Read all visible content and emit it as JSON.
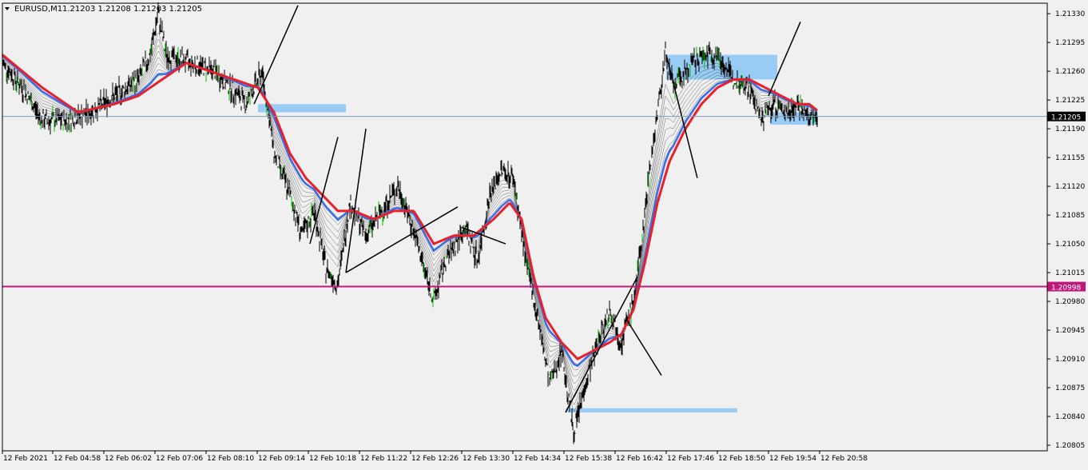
{
  "header": {
    "symbol": "EURUSD,M1",
    "ohlc": "1.21203 1.21208 1.21203 1.21205",
    "menu_icon": "triangle-down-icon"
  },
  "colors": {
    "background": "#f0f0f0",
    "axis": "#000000",
    "candles": "#000000",
    "bull_candle": "#00c000",
    "ma_red": "#e8202a",
    "ma_blue": "#3a6de8",
    "ma_ribbon": "#000000",
    "rect_fill": "#99ccf5",
    "current_price_line": "#7f9bb8",
    "level_line": "#c0187a"
  },
  "chart_data": {
    "type": "line",
    "title": "",
    "xlabel": "",
    "ylabel": "",
    "ylim": [
      1.20805,
      1.2135
    ],
    "y_ticks": [
      "1.21330",
      "1.21295",
      "1.21260",
      "1.21225",
      "1.21190",
      "1.21155",
      "1.21120",
      "1.21085",
      "1.21050",
      "1.21015",
      "1.20980",
      "1.20945",
      "1.20910",
      "1.20875",
      "1.20840",
      "1.20805"
    ],
    "x_ticks": [
      "12 Feb 2021",
      "12 Feb 04:58",
      "12 Feb 06:02",
      "12 Feb 07:06",
      "12 Feb 08:10",
      "12 Feb 09:14",
      "12 Feb 10:18",
      "12 Feb 11:22",
      "12 Feb 12:26",
      "12 Feb 13:30",
      "12 Feb 14:34",
      "12 Feb 15:38",
      "12 Feb 16:42",
      "12 Feb 17:46",
      "12 Feb 18:50",
      "12 Feb 19:54",
      "12 Feb 20:58"
    ],
    "current_price": {
      "value": 1.21205,
      "label": "1.21205"
    },
    "level_price": {
      "value": 1.20998,
      "label": "1.20998"
    },
    "price_path": [
      [
        "12 Feb 03:55",
        1.2127
      ],
      [
        "12 Feb 04:20",
        1.2124
      ],
      [
        "12 Feb 04:45",
        1.212
      ],
      [
        "12 Feb 05:15",
        1.212
      ],
      [
        "12 Feb 05:45",
        1.2121
      ],
      [
        "12 Feb 06:15",
        1.2123
      ],
      [
        "12 Feb 06:45",
        1.2125
      ],
      [
        "12 Feb 07:00",
        1.2128
      ],
      [
        "12 Feb 07:10",
        1.2133
      ],
      [
        "12 Feb 07:20",
        1.2128
      ],
      [
        "12 Feb 07:50",
        1.2127
      ],
      [
        "12 Feb 08:20",
        1.2126
      ],
      [
        "12 Feb 08:40",
        1.2124
      ],
      [
        "12 Feb 09:00",
        1.2122
      ],
      [
        "12 Feb 09:20",
        1.2126
      ],
      [
        "12 Feb 09:35",
        1.2116
      ],
      [
        "12 Feb 09:55",
        1.2111
      ],
      [
        "12 Feb 10:10",
        1.2106
      ],
      [
        "12 Feb 10:25",
        1.2109
      ],
      [
        "12 Feb 10:40",
        1.2102
      ],
      [
        "12 Feb 10:55",
        1.21
      ],
      [
        "12 Feb 11:10",
        1.211
      ],
      [
        "12 Feb 11:30",
        1.2106
      ],
      [
        "12 Feb 11:50",
        1.2109
      ],
      [
        "12 Feb 12:10",
        1.2112
      ],
      [
        "12 Feb 12:25",
        1.2108
      ],
      [
        "12 Feb 12:40",
        1.2103
      ],
      [
        "12 Feb 12:55",
        1.2098
      ],
      [
        "12 Feb 13:10",
        1.2103
      ],
      [
        "12 Feb 13:35",
        1.2107
      ],
      [
        "12 Feb 13:50",
        1.2103
      ],
      [
        "12 Feb 14:05",
        1.2111
      ],
      [
        "12 Feb 14:20",
        1.2114
      ],
      [
        "12 Feb 14:35",
        1.2113
      ],
      [
        "12 Feb 14:50",
        1.2103
      ],
      [
        "12 Feb 15:05",
        1.2096
      ],
      [
        "12 Feb 15:20",
        1.2088
      ],
      [
        "12 Feb 15:35",
        1.2092
      ],
      [
        "12 Feb 15:50",
        1.2082
      ],
      [
        "12 Feb 16:05",
        1.2088
      ],
      [
        "12 Feb 16:20",
        1.2093
      ],
      [
        "12 Feb 16:35",
        1.2097
      ],
      [
        "12 Feb 16:50",
        1.2093
      ],
      [
        "12 Feb 17:05",
        1.2098
      ],
      [
        "12 Feb 17:15",
        1.2105
      ],
      [
        "12 Feb 17:25",
        1.2114
      ],
      [
        "12 Feb 17:35",
        1.2121
      ],
      [
        "12 Feb 17:45",
        1.2128
      ],
      [
        "12 Feb 17:55",
        1.2124
      ],
      [
        "12 Feb 18:10",
        1.2126
      ],
      [
        "12 Feb 18:30",
        1.2128
      ],
      [
        "12 Feb 18:50",
        1.2128
      ],
      [
        "12 Feb 19:10",
        1.2125
      ],
      [
        "12 Feb 19:30",
        1.2124
      ],
      [
        "12 Feb 19:45",
        1.212
      ],
      [
        "12 Feb 20:00",
        1.2122
      ],
      [
        "12 Feb 20:15",
        1.2121
      ],
      [
        "12 Feb 20:30",
        1.2122
      ],
      [
        "12 Feb 20:45",
        1.212
      ],
      [
        "12 Feb 20:55",
        1.21205
      ]
    ],
    "ma_red_path": [
      [
        "12 Feb 03:55",
        1.2128
      ],
      [
        "12 Feb 04:45",
        1.2124
      ],
      [
        "12 Feb 05:30",
        1.2121
      ],
      [
        "12 Feb 06:15",
        1.2122
      ],
      [
        "12 Feb 06:45",
        1.2123
      ],
      [
        "12 Feb 07:15",
        1.2125
      ],
      [
        "12 Feb 07:45",
        1.2127
      ],
      [
        "12 Feb 08:15",
        1.2126
      ],
      [
        "12 Feb 08:45",
        1.2125
      ],
      [
        "12 Feb 09:15",
        1.2124
      ],
      [
        "12 Feb 09:35",
        1.2121
      ],
      [
        "12 Feb 09:55",
        1.2116
      ],
      [
        "12 Feb 10:15",
        1.2113
      ],
      [
        "12 Feb 10:35",
        1.2111
      ],
      [
        "12 Feb 10:55",
        1.2109
      ],
      [
        "12 Feb 11:15",
        1.2109
      ],
      [
        "12 Feb 11:40",
        1.2108
      ],
      [
        "12 Feb 12:05",
        1.2109
      ],
      [
        "12 Feb 12:30",
        1.2109
      ],
      [
        "12 Feb 12:55",
        1.2105
      ],
      [
        "12 Feb 13:20",
        1.2106
      ],
      [
        "12 Feb 13:45",
        1.2106
      ],
      [
        "12 Feb 14:10",
        1.2108
      ],
      [
        "12 Feb 14:30",
        1.211
      ],
      [
        "12 Feb 14:45",
        1.2108
      ],
      [
        "12 Feb 15:00",
        1.2101
      ],
      [
        "12 Feb 15:15",
        1.2096
      ],
      [
        "12 Feb 15:35",
        1.2093
      ],
      [
        "12 Feb 15:55",
        1.2091
      ],
      [
        "12 Feb 16:15",
        1.2092
      ],
      [
        "12 Feb 16:35",
        1.2093
      ],
      [
        "12 Feb 16:50",
        1.2094
      ],
      [
        "12 Feb 17:05",
        1.2097
      ],
      [
        "12 Feb 17:20",
        1.2103
      ],
      [
        "12 Feb 17:35",
        1.211
      ],
      [
        "12 Feb 17:50",
        1.2115
      ],
      [
        "12 Feb 18:10",
        1.2119
      ],
      [
        "12 Feb 18:30",
        1.2122
      ],
      [
        "12 Feb 18:50",
        1.2124
      ],
      [
        "12 Feb 19:10",
        1.2125
      ],
      [
        "12 Feb 19:30",
        1.2125
      ],
      [
        "12 Feb 19:50",
        1.2124
      ],
      [
        "12 Feb 20:10",
        1.2123
      ],
      [
        "12 Feb 20:30",
        1.2122
      ],
      [
        "12 Feb 20:45",
        1.2122
      ],
      [
        "12 Feb 20:58",
        1.2121
      ]
    ],
    "rectangles": [
      {
        "x0": "12 Feb 09:15",
        "x1": "12 Feb 11:05",
        "y0": 1.2121,
        "y1": 1.2122
      },
      {
        "x0": "12 Feb 17:46",
        "x1": "12 Feb 20:05",
        "y0": 1.2125,
        "y1": 1.2128
      },
      {
        "x0": "12 Feb 19:56",
        "x1": "12 Feb 20:56",
        "y0": 1.21195,
        "y1": 1.2121
      },
      {
        "x0": "12 Feb 15:40",
        "x1": "12 Feb 19:15",
        "y0": 1.20845,
        "y1": 1.2085
      }
    ],
    "trendlines": [
      [
        [
          "12 Feb 09:10",
          1.2122
        ],
        [
          "12 Feb 10:05",
          1.2134
        ]
      ],
      [
        [
          "12 Feb 10:20",
          1.2105
        ],
        [
          "12 Feb 10:55",
          1.2118
        ]
      ],
      [
        [
          "12 Feb 11:05",
          1.21015
        ],
        [
          "12 Feb 11:30",
          1.2119
        ]
      ],
      [
        [
          "12 Feb 11:05",
          1.21015
        ],
        [
          "12 Feb 13:25",
          1.21095
        ]
      ],
      [
        [
          "12 Feb 13:30",
          1.2107
        ],
        [
          "12 Feb 14:25",
          1.2105
        ]
      ],
      [
        [
          "12 Feb 15:40",
          1.20845
        ],
        [
          "12 Feb 17:10",
          1.2101
        ]
      ],
      [
        [
          "12 Feb 16:55",
          1.2096
        ],
        [
          "12 Feb 17:40",
          1.2089
        ]
      ],
      [
        [
          "12 Feb 17:46",
          1.2128
        ],
        [
          "12 Feb 18:25",
          1.2113
        ]
      ],
      [
        [
          "12 Feb 19:54",
          1.2123
        ],
        [
          "12 Feb 20:34",
          1.2132
        ]
      ]
    ]
  }
}
